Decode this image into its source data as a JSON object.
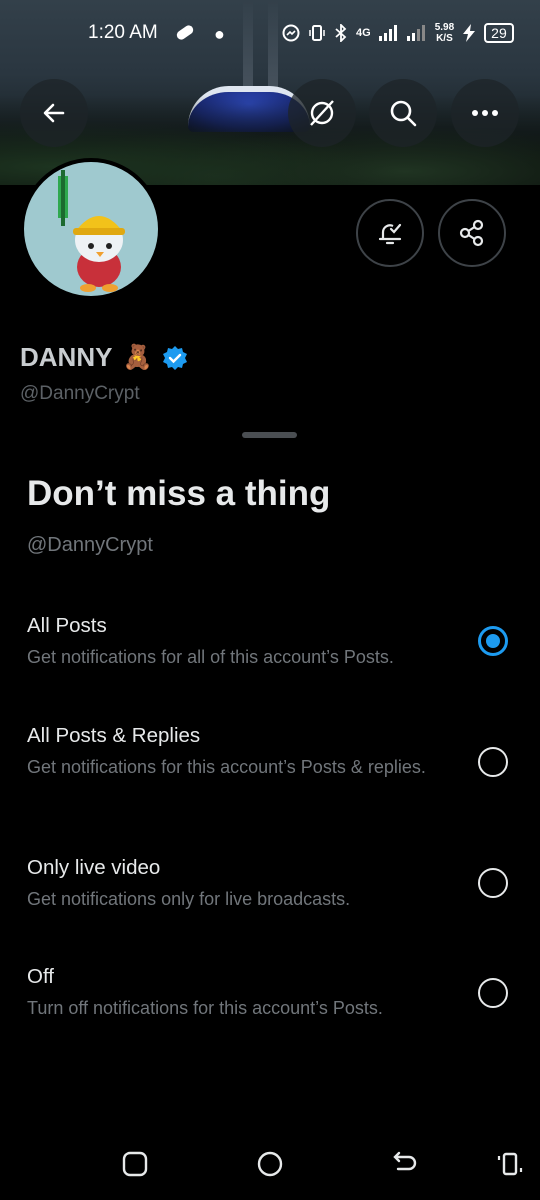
{
  "status": {
    "time": "1:20 AM",
    "network": "4G",
    "speed_top": "5.98",
    "speed_bottom": "K/S",
    "battery": "29"
  },
  "profile": {
    "name": "DANNY",
    "name_emoji": "🧸",
    "handle": "@DannyCrypt"
  },
  "sheet": {
    "title": "Don’t miss a thing",
    "handle": "@DannyCrypt",
    "options": [
      {
        "label": "All Posts",
        "desc": "Get notifications for all of this account’s Posts.",
        "selected": true
      },
      {
        "label": "All Posts & Replies",
        "desc": "Get notifications for this account’s Posts & replies.",
        "selected": false
      },
      {
        "label": "Only live video",
        "desc": "Get notifications only for live broadcasts.",
        "selected": false
      },
      {
        "label": "Off",
        "desc": "Turn off notifications for this account’s Posts.",
        "selected": false
      }
    ]
  },
  "colors": {
    "accent": "#1d9bf0",
    "background": "#000000",
    "secondary_text": "#71767b"
  },
  "icons": [
    "back-arrow-icon",
    "grok-icon",
    "search-icon",
    "more-icon",
    "bell-check-icon",
    "share-icon",
    "verified-badge-icon",
    "recents-icon",
    "home-icon",
    "back-icon",
    "rotate-icon"
  ]
}
